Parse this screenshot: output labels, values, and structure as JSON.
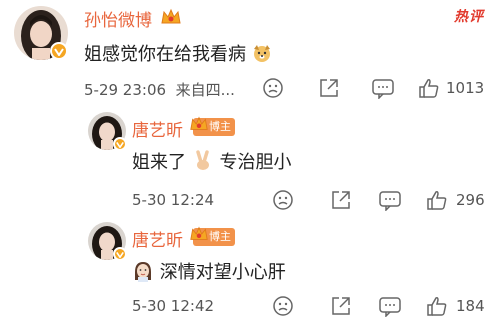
{
  "hot_tag": "热评",
  "comments": [
    {
      "username": "孙怡微博",
      "text": "姐感觉你在给我看病",
      "time": "5-29 23:06",
      "source": "来自四...",
      "likes": "1013"
    },
    {
      "username": "唐艺昕",
      "badge": "博主",
      "text": "姐来了",
      "text2": "专治胆小",
      "time": "5-30 12:24",
      "likes": "296"
    },
    {
      "username": "唐艺昕",
      "badge": "博主",
      "text": "深情对望小心肝",
      "time": "5-30 12:42",
      "likes": "184"
    }
  ],
  "icons": {
    "dislike": "sad-face-icon",
    "share": "share-icon",
    "comment": "comment-bubble-icon",
    "like": "thumbs-up-icon"
  },
  "colors": {
    "username": "#e8663d",
    "badge": "#f2924a",
    "hot": "#e23b2e",
    "verified": "#f5a623"
  }
}
